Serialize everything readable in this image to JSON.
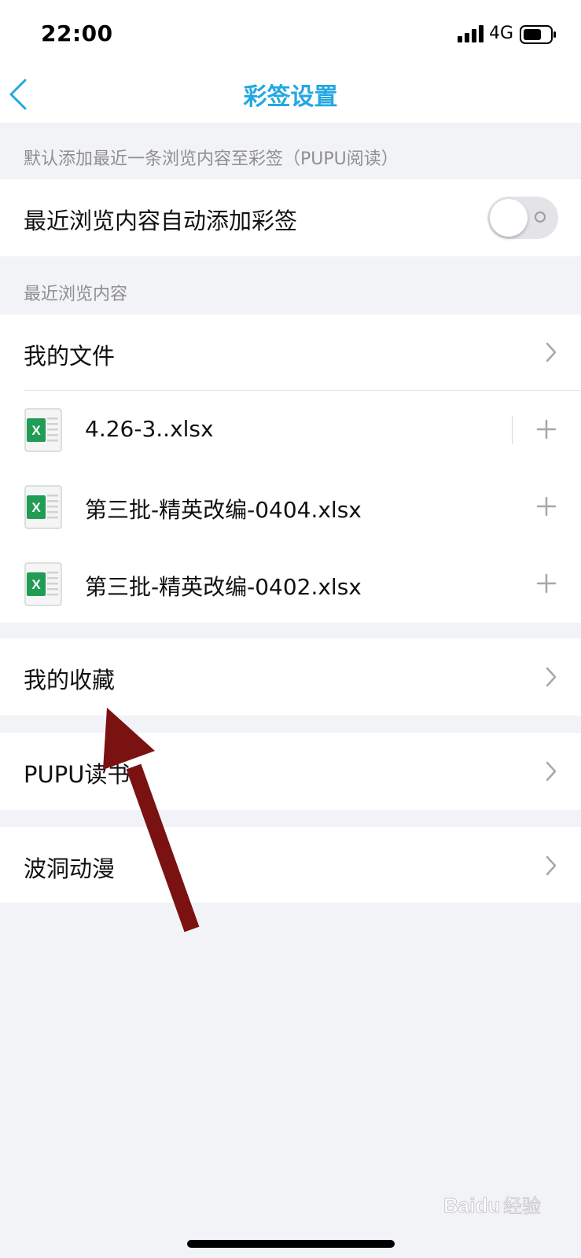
{
  "status_bar": {
    "time": "22:00",
    "network": "4G",
    "icons": [
      "signal-icon",
      "battery-icon"
    ]
  },
  "nav": {
    "title": "彩签设置",
    "back_icon": "chevron-left-icon"
  },
  "auto_add_section": {
    "caption": "默认添加最近一条浏览内容至彩签（PUPU阅读）",
    "toggle_label": "最近浏览内容自动添加彩签",
    "toggle_on": false
  },
  "recent_section": {
    "caption": "最近浏览内容",
    "my_files": {
      "label": "我的文件",
      "files": [
        {
          "name": "4.26-3..xlsx",
          "icon": "excel-file-icon",
          "action_icon": "plus-icon"
        },
        {
          "name": "第三批-精英改编-0404.xlsx",
          "icon": "excel-file-icon",
          "action_icon": "plus-icon"
        },
        {
          "name": "第三批-精英改编-0402.xlsx",
          "icon": "excel-file-icon",
          "action_icon": "plus-icon"
        }
      ]
    },
    "other_items": [
      {
        "label": "我的收藏"
      },
      {
        "label": "PUPU读书"
      },
      {
        "label": "波洞动漫"
      }
    ]
  },
  "annotation": {
    "type": "arrow",
    "color": "#7b1212",
    "points_to": "我的收藏"
  },
  "watermark": {
    "text": "Baidu经验"
  },
  "colors": {
    "accent": "#23a7e3",
    "excel_green": "#1f9d55",
    "background": "#f2f3f7",
    "caption_gray": "#8e8e93"
  }
}
